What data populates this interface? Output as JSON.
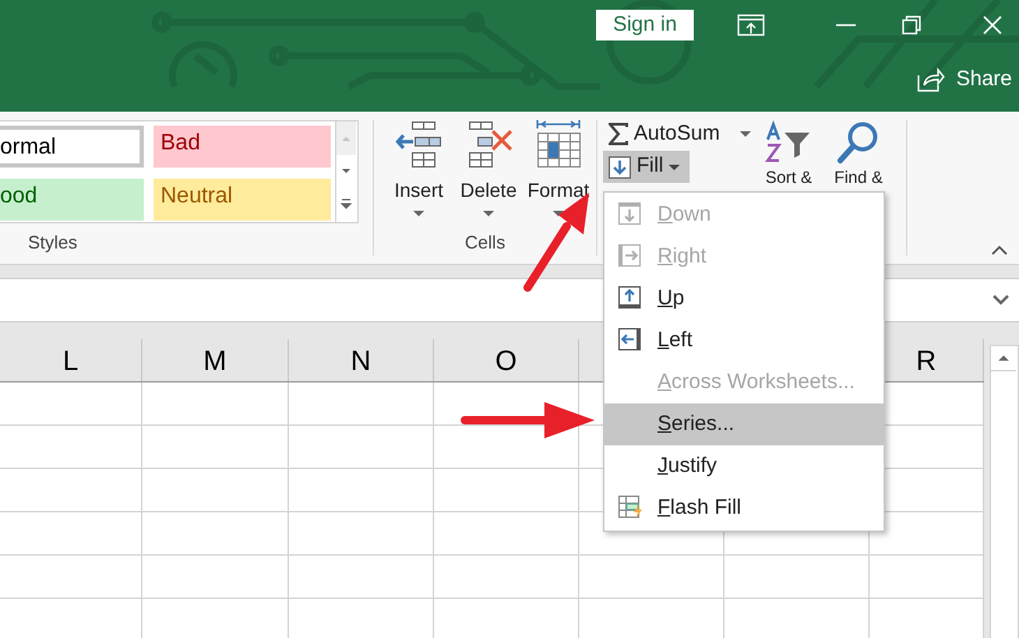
{
  "title_bar": {
    "sign_in": "Sign in",
    "share": "Share"
  },
  "styles_group": {
    "cells": [
      {
        "label": "ormal",
        "kind": "normal"
      },
      {
        "label": "Bad",
        "kind": "bad"
      },
      {
        "label": "ood",
        "kind": "good"
      },
      {
        "label": "Neutral",
        "kind": "neutral"
      }
    ],
    "label": "Styles"
  },
  "cells_group": {
    "buttons": [
      {
        "label": "Insert",
        "kind": "insert"
      },
      {
        "label": "Delete",
        "kind": "delete"
      },
      {
        "label": "Format",
        "kind": "format"
      }
    ],
    "label": "Cells"
  },
  "editing_group": {
    "autosum": "AutoSum",
    "fill": {
      "label": "Fill",
      "expanded": true
    },
    "sort": "Sort &",
    "find": "Find &"
  },
  "sheet": {
    "column_labels": [
      "L",
      "M",
      "N",
      "O",
      "R"
    ]
  },
  "fill_menu": {
    "items": [
      {
        "label": "Down",
        "kind": "down",
        "disabled": true,
        "selected": false
      },
      {
        "label": "Right",
        "kind": "right",
        "disabled": true,
        "selected": false
      },
      {
        "label": "Up",
        "kind": "up",
        "disabled": false,
        "selected": false
      },
      {
        "label": "Left",
        "kind": "left",
        "disabled": false,
        "selected": false
      },
      {
        "label": "Across Worksheets...",
        "kind": "plain",
        "disabled": true,
        "selected": false
      },
      {
        "label": "Series...",
        "kind": "plain",
        "disabled": false,
        "selected": true
      },
      {
        "label": "Justify",
        "kind": "plain",
        "disabled": false,
        "selected": false
      },
      {
        "label": "Flash Fill",
        "kind": "flash",
        "disabled": false,
        "selected": false
      }
    ]
  }
}
